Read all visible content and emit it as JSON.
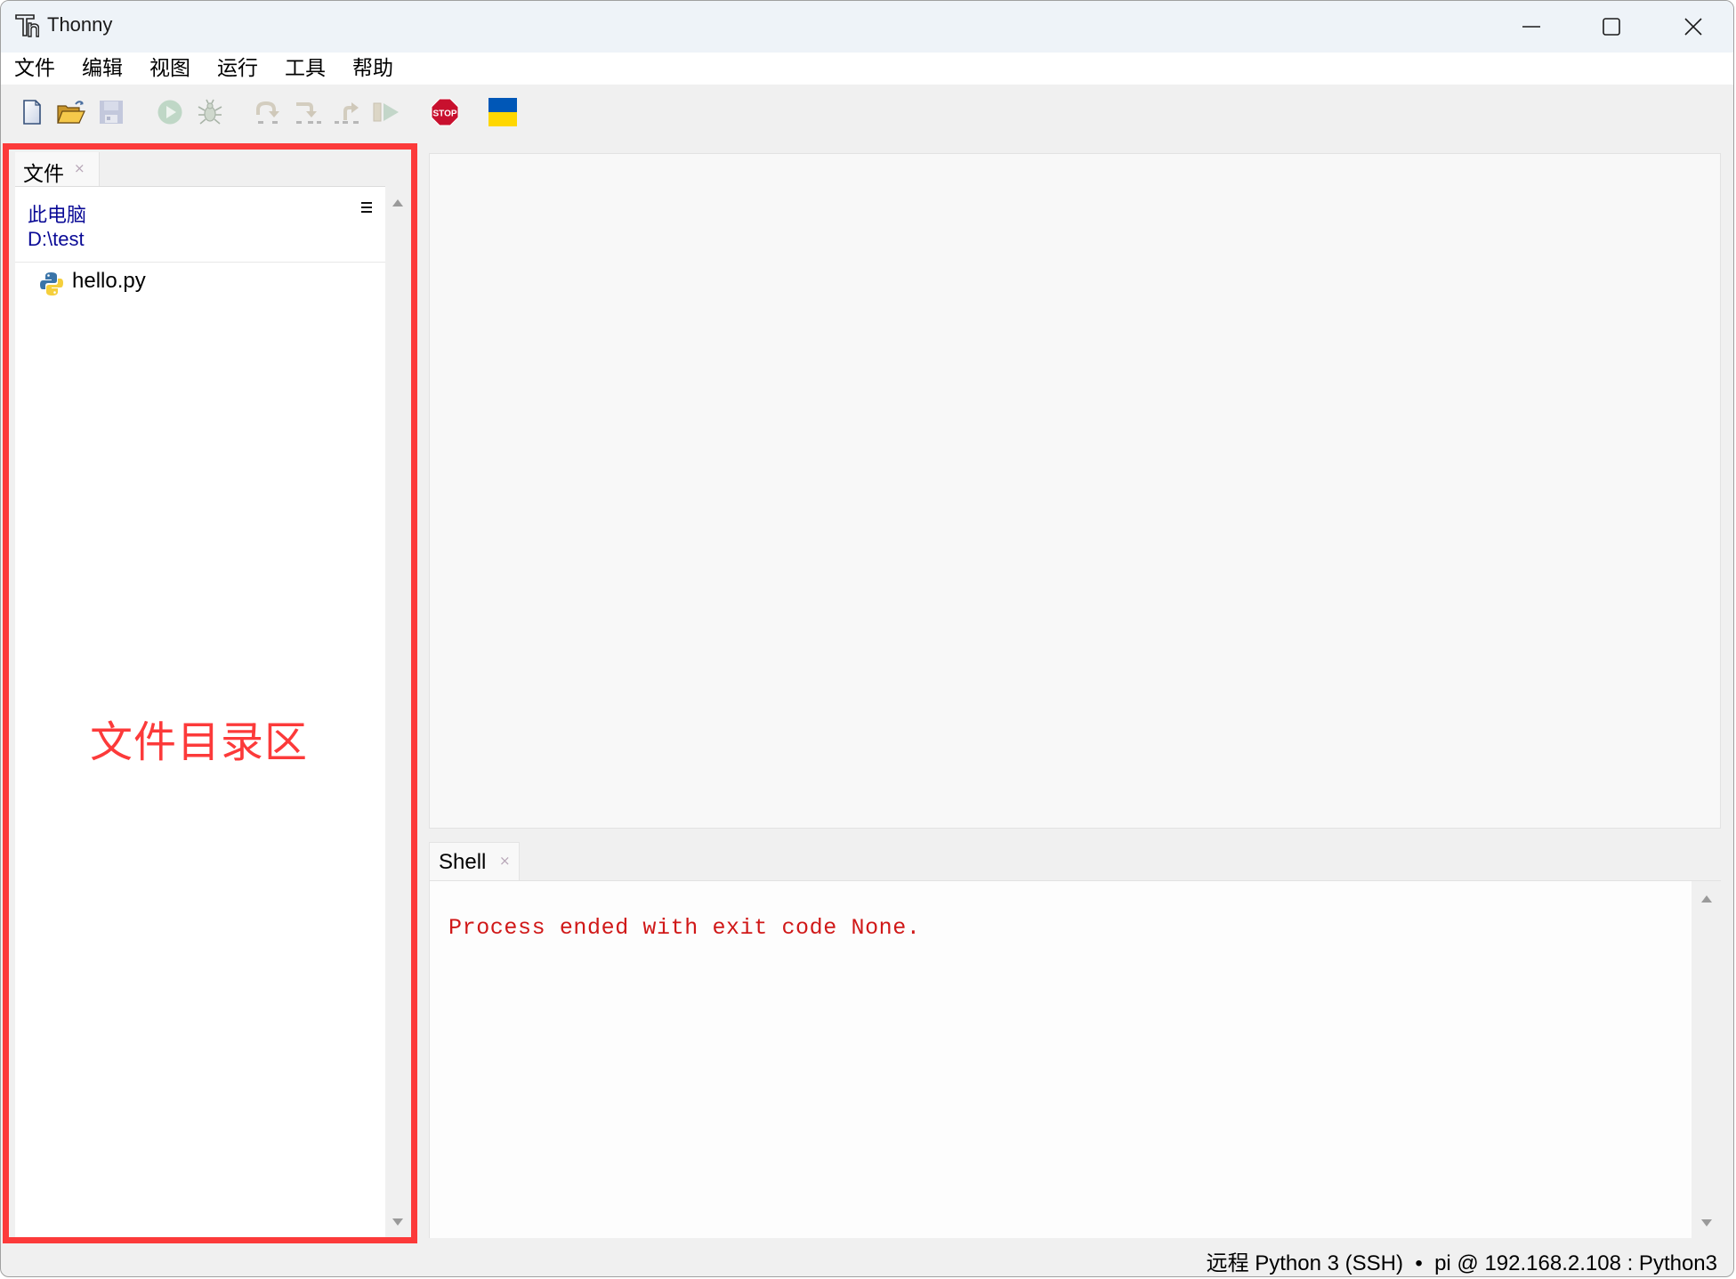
{
  "window": {
    "title": "Thonny",
    "controls": {
      "minimize": "minimize",
      "maximize": "maximize",
      "close": "close"
    }
  },
  "menu": {
    "items": [
      {
        "label": "文件"
      },
      {
        "label": "编辑"
      },
      {
        "label": "视图"
      },
      {
        "label": "运行"
      },
      {
        "label": "工具"
      },
      {
        "label": "帮助"
      }
    ]
  },
  "toolbar": {
    "buttons": [
      {
        "name": "new-file",
        "icon": "new-file-icon",
        "enabled": true
      },
      {
        "name": "open-file",
        "icon": "open-folder-icon",
        "enabled": true
      },
      {
        "name": "save-file",
        "icon": "save-disk-icon",
        "enabled": false
      },
      {
        "name": "run",
        "icon": "run-icon",
        "enabled": false
      },
      {
        "name": "debug",
        "icon": "bug-icon",
        "enabled": false
      },
      {
        "name": "step-over",
        "icon": "step-over-icon",
        "enabled": false
      },
      {
        "name": "step-into",
        "icon": "step-into-icon",
        "enabled": false
      },
      {
        "name": "step-out",
        "icon": "step-out-icon",
        "enabled": false
      },
      {
        "name": "resume",
        "icon": "resume-icon",
        "enabled": false
      },
      {
        "name": "stop",
        "icon": "stop-sign-icon",
        "label": "STOP",
        "enabled": true
      },
      {
        "name": "support-ukraine",
        "icon": "ukraine-flag-icon",
        "enabled": true
      }
    ],
    "colors": {
      "stop_red": "#c8102e",
      "flag_blue": "#0057b7",
      "flag_yellow": "#ffd700"
    }
  },
  "files_panel": {
    "tab_label": "文件",
    "tab_close": "×",
    "location_line1": "此电脑",
    "location_line2": "D:\\test",
    "files": [
      {
        "name": "hello.py",
        "icon": "python-file-icon"
      }
    ],
    "link_color": "#0a0a96"
  },
  "annotation": {
    "label": "文件目录区",
    "color": "#fc3a3a"
  },
  "editor": {
    "content": ""
  },
  "shell": {
    "tab_label": "Shell",
    "tab_close": "×",
    "output": "Process ended with exit code None.",
    "output_color": "#d01818"
  },
  "status_bar": {
    "text": "远程 Python 3 (SSH)  •  pi @ 192.168.2.108 : Python3"
  }
}
